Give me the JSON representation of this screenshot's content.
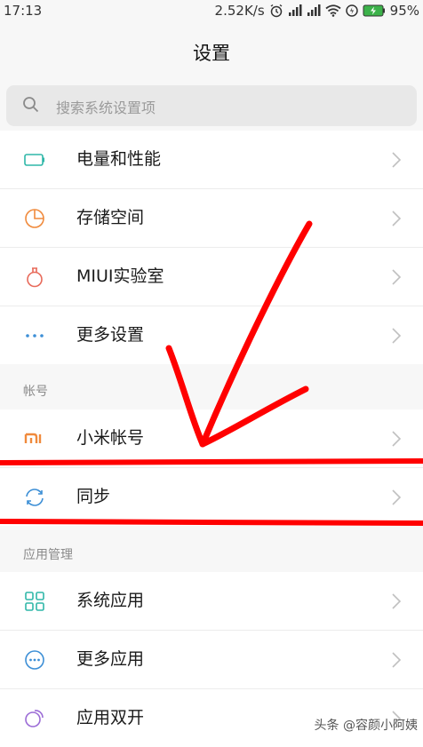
{
  "status_bar": {
    "time": "17:13",
    "net_speed": "2.52K/s",
    "battery": "95%"
  },
  "header": {
    "title": "设置"
  },
  "search": {
    "placeholder": "搜索系统设置项"
  },
  "group1": {
    "items": [
      {
        "label": "电量和性能",
        "icon": "battery-icon"
      },
      {
        "label": "存储空间",
        "icon": "storage-pie-icon"
      },
      {
        "label": "MIUI实验室",
        "icon": "lab-flask-icon"
      },
      {
        "label": "更多设置",
        "icon": "more-dots-icon"
      }
    ]
  },
  "account_section": {
    "title": "帐号",
    "items": [
      {
        "label": "小米帐号",
        "icon": "mi-logo-icon"
      },
      {
        "label": "同步",
        "icon": "sync-icon"
      }
    ]
  },
  "apps_section": {
    "title": "应用管理",
    "items": [
      {
        "label": "系统应用",
        "icon": "grid-apps-icon"
      },
      {
        "label": "更多应用",
        "icon": "more-apps-icon"
      },
      {
        "label": "应用双开",
        "icon": "dual-apps-icon"
      }
    ]
  },
  "watermark": {
    "text": "头条 @容颜小阿姨"
  },
  "colors": {
    "accent_teal": "#2fb7a8",
    "accent_orange": "#f08a3c",
    "accent_blue": "#3d8fd6",
    "accent_purple": "#9b6bd6",
    "annotation_red": "#ff0000"
  }
}
